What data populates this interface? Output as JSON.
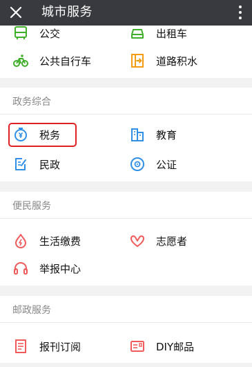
{
  "header": {
    "title": "城市服务"
  },
  "transport": {
    "items": [
      {
        "label": "公交",
        "icon": "bus-icon"
      },
      {
        "label": "出租车",
        "icon": "taxi-icon"
      },
      {
        "label": "公共自行车",
        "icon": "bicycle-icon"
      },
      {
        "label": "道路积水",
        "icon": "road-water-icon"
      }
    ]
  },
  "government": {
    "title": "政务综合",
    "items": [
      {
        "label": "税务",
        "icon": "tax-coin-icon"
      },
      {
        "label": "教育",
        "icon": "school-building-icon"
      },
      {
        "label": "民政",
        "icon": "document-edit-icon"
      },
      {
        "label": "公证",
        "icon": "seal-icon"
      }
    ]
  },
  "convenience": {
    "title": "便民服务",
    "items": [
      {
        "label": "生活缴费",
        "icon": "flame-drop-icon"
      },
      {
        "label": "志愿者",
        "icon": "heart-hands-icon"
      },
      {
        "label": "举报中心",
        "icon": "headset-icon"
      }
    ]
  },
  "postal": {
    "title": "邮政服务",
    "items": [
      {
        "label": "报刊订阅",
        "icon": "newspaper-icon"
      },
      {
        "label": "DIY邮品",
        "icon": "postcard-icon"
      }
    ]
  },
  "colors": {
    "topbar": "#393a3f",
    "green": "#3fae29",
    "blue": "#2f8fe6",
    "orange": "#f39c12",
    "red": "#f05a5a",
    "highlight": "#e02020"
  }
}
